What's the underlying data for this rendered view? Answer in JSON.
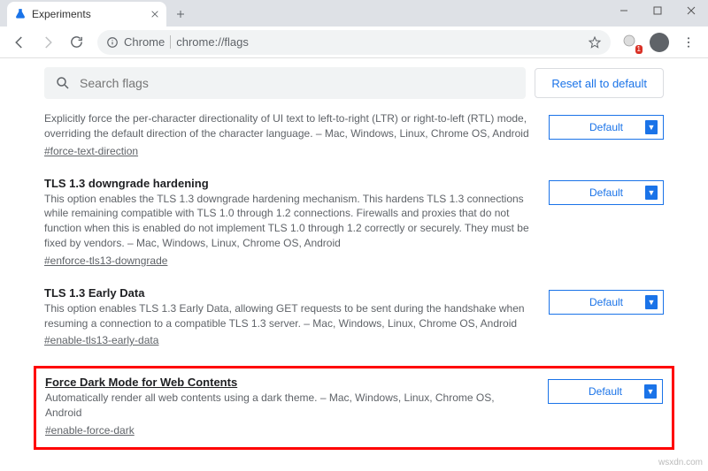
{
  "window": {
    "tab_title": "Experiments"
  },
  "toolbar": {
    "origin_label": "Chrome",
    "url": "chrome://flags",
    "ext_badge": "1"
  },
  "search": {
    "placeholder": "Search flags"
  },
  "reset_label": "Reset all to default",
  "flags": [
    {
      "title": "",
      "desc": "Explicitly force the per-character directionality of UI text to left-to-right (LTR) or right-to-left (RTL) mode, overriding the default direction of the character language. – Mac, Windows, Linux, Chrome OS, Android",
      "link": "#force-text-direction",
      "select": "Default"
    },
    {
      "title": "TLS 1.3 downgrade hardening",
      "desc": "This option enables the TLS 1.3 downgrade hardening mechanism. This hardens TLS 1.3 connections while remaining compatible with TLS 1.0 through 1.2 connections. Firewalls and proxies that do not function when this is enabled do not implement TLS 1.0 through 1.2 correctly or securely. They must be fixed by vendors. – Mac, Windows, Linux, Chrome OS, Android",
      "link": "#enforce-tls13-downgrade",
      "select": "Default"
    },
    {
      "title": "TLS 1.3 Early Data",
      "desc": "This option enables TLS 1.3 Early Data, allowing GET requests to be sent during the handshake when resuming a connection to a compatible TLS 1.3 server. – Mac, Windows, Linux, Chrome OS, Android",
      "link": "#enable-tls13-early-data",
      "select": "Default"
    },
    {
      "title": "Force Dark Mode for Web Contents",
      "desc": "Automatically render all web contents using a dark theme. – Mac, Windows, Linux, Chrome OS, Android",
      "link": "#enable-force-dark",
      "select": "Default"
    }
  ],
  "watermark": "wsxdn.com"
}
